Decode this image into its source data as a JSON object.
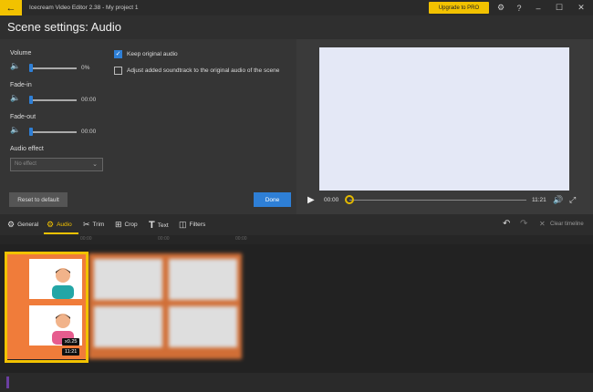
{
  "titlebar": {
    "title": "Icecream Video Editor 2.38  -  My project 1",
    "upgrade_label": "Upgrade to PRO"
  },
  "header": {
    "title": "Scene settings: Audio"
  },
  "settings": {
    "volume_label": "Volume",
    "volume_value": "0%",
    "volume_level": 0,
    "fadein_label": "Fade-in",
    "fadein_value": "00:00",
    "fadeout_label": "Fade-out",
    "fadeout_value": "00:00",
    "effect_label": "Audio effect",
    "effect_selected": "No effect",
    "keep_original_label": "Keep original audio",
    "keep_original_checked": true,
    "adjust_label": "Adjust added soundtrack to the original audio of the scene",
    "adjust_checked": false,
    "reset_label": "Reset to default",
    "done_label": "Done"
  },
  "player": {
    "current_time": "00:00",
    "duration": "11:21"
  },
  "toolbar": {
    "tabs": [
      {
        "label": "General",
        "icon": "gear-icon"
      },
      {
        "label": "Audio",
        "icon": "gear-icon"
      },
      {
        "label": "Trim",
        "icon": "scissors-icon"
      },
      {
        "label": "Crop",
        "icon": "crop-icon"
      },
      {
        "label": "Text",
        "icon": "text-icon"
      },
      {
        "label": "Filters",
        "icon": "filters-icon"
      }
    ],
    "active_tab": "Audio",
    "clear_label": "Clear timeline"
  },
  "ruler": {
    "marks": [
      "00:00",
      "00:00",
      "00:00"
    ]
  },
  "timeline": {
    "clip_speed": "x0.25",
    "clip_duration": "11:21"
  },
  "colors": {
    "accent": "#f2c200",
    "primary": "#2e7fd6",
    "clip_bg": "#f07c3a"
  }
}
